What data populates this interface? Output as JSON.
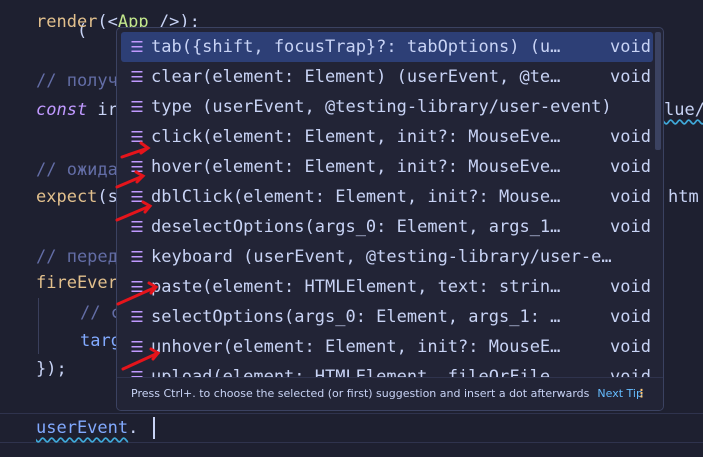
{
  "editor": {
    "lines": [
      {
        "id": "l0",
        "text_fn": "render",
        "text_rest": "(<",
        "tag": "App",
        "tail": " />);"
      },
      {
        "id": "l1",
        "comment": "// получ"
      },
      {
        "id": "l2",
        "keyword": "const",
        "rest": " ir",
        "suffix": "lue/"
      },
      {
        "id": "l3",
        "comment": "// ожида"
      },
      {
        "id": "l4",
        "fn": "expect",
        "rest": "(s",
        "suffix": "htm"
      },
      {
        "id": "l5",
        "comment": "// перед"
      },
      {
        "id": "l6",
        "var": "fireEver"
      },
      {
        "id": "l7",
        "comment": "// c"
      },
      {
        "id": "l8",
        "var": "targ"
      },
      {
        "id": "l9",
        "text": "});"
      },
      {
        "id": "l10",
        "var": "userEvent",
        "punct": "."
      }
    ]
  },
  "suggest_widget": {
    "items": [
      {
        "icon": "method-icon",
        "label": "tab({shift, focusTrap}?: tabOptions) (u…",
        "type": "void",
        "selected": true
      },
      {
        "icon": "method-icon",
        "label": "clear(element: Element) (userEvent, @te…",
        "type": "void",
        "selected": false
      },
      {
        "icon": "method-icon",
        "label": "type (userEvent, @testing-library/user-event)",
        "type": "",
        "selected": false
      },
      {
        "icon": "method-icon",
        "label": "click(element: Element, init?: MouseEve…",
        "type": "void",
        "selected": false
      },
      {
        "icon": "method-icon",
        "label": "hover(element: Element, init?: MouseEve…",
        "type": "void",
        "selected": false
      },
      {
        "icon": "method-icon",
        "label": "dblClick(element: Element, init?: Mouse…",
        "type": "void",
        "selected": false
      },
      {
        "icon": "method-icon",
        "label": "deselectOptions(args_0: Element, args_1…",
        "type": "void",
        "selected": false
      },
      {
        "icon": "method-icon",
        "label": "keyboard (userEvent, @testing-library/user-e…",
        "type": "",
        "selected": false
      },
      {
        "icon": "method-icon",
        "label": "paste(element: HTMLElement, text: strin…",
        "type": "void",
        "selected": false
      },
      {
        "icon": "method-icon",
        "label": "selectOptions(args_0: Element, args_1: …",
        "type": "void",
        "selected": false
      },
      {
        "icon": "method-icon",
        "label": "unhover(element: Element, init?: MouseE…",
        "type": "void",
        "selected": false
      },
      {
        "icon": "method-icon",
        "label": "upload(element: HTMLElement, fileOrFile…",
        "type": "void",
        "selected": false
      }
    ],
    "status_text": "Press Ctrl+. to choose the selected (or first) suggestion and insert a dot afterwards",
    "next_tip": "Next Tip",
    "more_icon": "⋮"
  },
  "colors": {
    "background": "#1e2030",
    "selected_row": "#2d3f76",
    "arrow": "#e5141b",
    "accent": "#65bcff"
  }
}
